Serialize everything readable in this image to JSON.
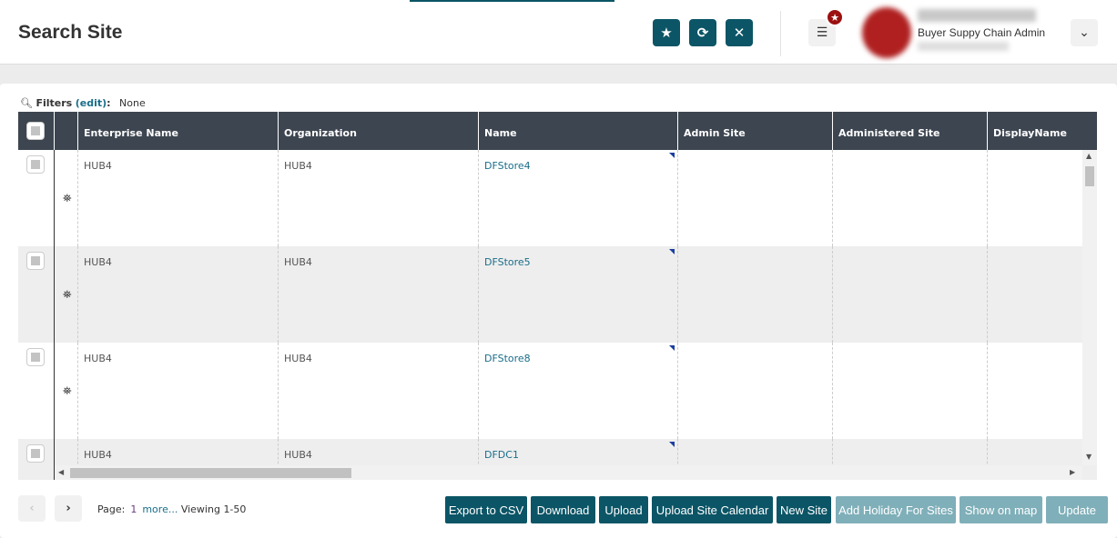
{
  "header": {
    "title": "Search Site",
    "role": "Buyer Suppy Chain Admin"
  },
  "filters": {
    "label": "Filters",
    "edit": "(edit)",
    "colon": ":",
    "value": "None"
  },
  "columns": [
    "Enterprise Name",
    "Organization",
    "Name",
    "Admin Site",
    "Administered Site",
    "DisplayName"
  ],
  "rows": [
    {
      "enterprise": "HUB4",
      "organization": "HUB4",
      "name": "DFStore4"
    },
    {
      "enterprise": "HUB4",
      "organization": "HUB4",
      "name": "DFStore5"
    },
    {
      "enterprise": "HUB4",
      "organization": "HUB4",
      "name": "DFStore8"
    },
    {
      "enterprise": "HUB4",
      "organization": "HUB4",
      "name": "DFDC1"
    }
  ],
  "pager": {
    "page_label": "Page:",
    "page": "1",
    "more": "more...",
    "viewing": "Viewing 1-50"
  },
  "actions": [
    "Export to CSV",
    "Download",
    "Upload",
    "Upload Site Calendar",
    "New Site",
    "Add Holiday For Sites",
    "Show on map",
    "Update"
  ],
  "colors": {
    "primary": "#0b5566",
    "disabled": "#7fafb9",
    "header": "#3d4550"
  }
}
